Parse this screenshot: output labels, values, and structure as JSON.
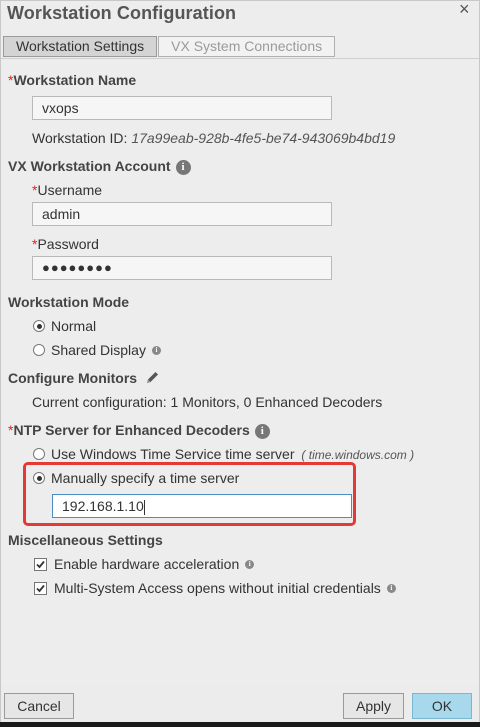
{
  "dialog": {
    "title": "Workstation Configuration",
    "close": "×"
  },
  "tabs": [
    {
      "label": "Workstation Settings",
      "active": true
    },
    {
      "label": "VX System Connections",
      "active": false
    }
  ],
  "workstation_name": {
    "label": "Workstation Name",
    "value": "vxops",
    "id_label": "Workstation ID:",
    "id_value": "17a99eab-928b-4fe5-be74-943069b4bd19"
  },
  "account": {
    "heading": "VX Workstation Account",
    "username_label": "Username",
    "username_value": "admin",
    "password_label": "Password",
    "password_value": "●●●●●●●●"
  },
  "mode": {
    "heading": "Workstation Mode",
    "options": [
      {
        "label": "Normal",
        "selected": true
      },
      {
        "label": "Shared Display",
        "selected": false
      }
    ]
  },
  "monitors": {
    "heading": "Configure Monitors",
    "current": "Current configuration: 1 Monitors, 0 Enhanced Decoders"
  },
  "ntp": {
    "heading": "NTP Server for Enhanced Decoders",
    "option_windows": "Use Windows Time Service time server",
    "option_windows_hint": "( time.windows.com )",
    "option_manual": "Manually specify a time server",
    "manual_selected": true,
    "server_value": "192.168.1.10"
  },
  "misc": {
    "heading": "Miscellaneous Settings",
    "options": [
      {
        "label": "Enable hardware acceleration",
        "checked": true
      },
      {
        "label": "Multi-System Access opens without initial credentials",
        "checked": true
      }
    ]
  },
  "footer": {
    "cancel": "Cancel",
    "apply": "Apply",
    "ok": "OK"
  },
  "colors": {
    "highlight": "#e53935",
    "required": "#d9261c",
    "ok_button": "#a8d8ec"
  }
}
